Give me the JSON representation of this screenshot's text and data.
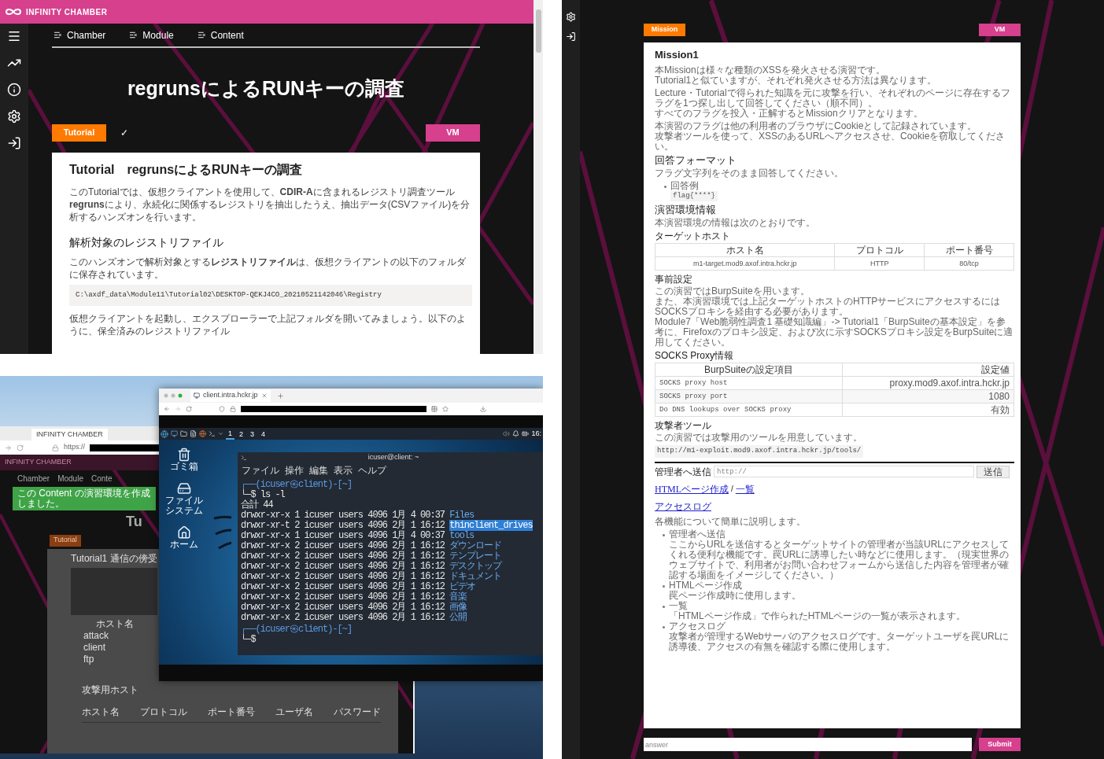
{
  "tutorial_page": {
    "brand": "INFINITY CHAMBER",
    "nav": [
      {
        "label": "Chamber"
      },
      {
        "label": "Module"
      },
      {
        "label": "Content"
      }
    ],
    "title": "regrunsによるRUNキーの調査",
    "tutorial_button": "Tutorial",
    "status_mark": "✓",
    "vm_button": "VM",
    "card": {
      "heading": "Tutorial　regrunsによるRUNキーの調査",
      "intro": "このTutorialでは、仮想クライアントを使用して、**CDIR-A**に含まれるレジストリ調査ツール**regruns**により、永続化に関係するレジストリを抽出したうえ、抽出データ(CSVファイル)を分析するハンズオンを行います。",
      "section": "解析対象のレジストリファイル",
      "paragraph": "このハンズオンで解析対象とする**レジストリファイル**は、仮想クライアントの以下のフォルダに保存されています。",
      "code": "C:\\axdf_data\\Module11\\Tutorial02\\DESKTOP-QEKJ4CO_20210521142046\\Registry",
      "paragraph_2": "仮想クライアントを起動し、エクスプローラーで上記フォルダを開いてみましょう。以下のように、保全済みのレジストリファイル"
    }
  },
  "desktop": {
    "back_window": {
      "tab": "INFINITY CHAMBER",
      "url": "https://",
      "brand": "INFINITY CHAMBER",
      "nav": [
        "Chamber",
        "Module",
        "Conte"
      ],
      "toast": "この Content の演習環境を作成しました。",
      "title": "Tu",
      "tutorial_button": "Tutorial",
      "card_heading": "Tutorial1 通信の傍受",
      "host_table": [
        "ホスト名",
        "attack",
        "client",
        "ftp"
      ],
      "section": "攻撃用ホスト",
      "table_columns": [
        "ホスト名",
        "プロトコル",
        "ポート番号",
        "ユーザ名",
        "パスワード"
      ]
    },
    "front_window": {
      "tab": "client.intra.hckr.jp",
      "workspaces": [
        {
          "label": "1",
          "selected": true
        },
        {
          "label": "2",
          "selected": false
        },
        {
          "label": "3",
          "selected": false
        },
        {
          "label": "4",
          "selected": false
        }
      ],
      "clock": "16:",
      "desktop_icons": [
        {
          "label": "ゴミ箱",
          "kind": "trash"
        },
        {
          "label": "ファイルシステム",
          "kind": "drive"
        },
        {
          "label": "ホーム",
          "kind": "home"
        }
      ],
      "terminal": {
        "title": "icuser@client: ~",
        "menu": [
          "ファイル",
          "操作",
          "編集",
          "表示",
          "ヘルプ"
        ],
        "lines": [
          {
            "kind": "prompt",
            "text": "┌──(icuser㉿client)-[~]"
          },
          {
            "kind": "command",
            "text": "└─$ ls -l"
          },
          {
            "kind": "output",
            "text": "合計 44"
          },
          {
            "kind": "entry",
            "meta": "drwxr-xr-x 1 icuser users 4096 1月 4 00:37",
            "name": "Files",
            "selected": false
          },
          {
            "kind": "entry",
            "meta": "drwxr-xr-t 2 icuser users 4096 2月 1 16:12",
            "name": "thinclient_drives",
            "selected": true
          },
          {
            "kind": "entry",
            "meta": "drwxr-xr-x 1 icuser users 4096 1月 4 00:37",
            "name": "tools",
            "selected": false
          },
          {
            "kind": "entry",
            "meta": "drwxr-xr-x 2 icuser users 4096 2月 1 16:12",
            "name": "ダウンロード",
            "selected": false
          },
          {
            "kind": "entry",
            "meta": "drwxr-xr-x 2 icuser users 4096 2月 1 16:12",
            "name": "テンプレート",
            "selected": false
          },
          {
            "kind": "entry",
            "meta": "drwxr-xr-x 2 icuser users 4096 2月 1 16:12",
            "name": "デスクトップ",
            "selected": false
          },
          {
            "kind": "entry",
            "meta": "drwxr-xr-x 2 icuser users 4096 2月 1 16:12",
            "name": "ドキュメント",
            "selected": false
          },
          {
            "kind": "entry",
            "meta": "drwxr-xr-x 2 icuser users 4096 2月 1 16:12",
            "name": "ビデオ",
            "selected": false
          },
          {
            "kind": "entry",
            "meta": "drwxr-xr-x 2 icuser users 4096 2月 1 16:12",
            "name": "音楽",
            "selected": false
          },
          {
            "kind": "entry",
            "meta": "drwxr-xr-x 2 icuser users 4096 2月 1 16:12",
            "name": "画像",
            "selected": false
          },
          {
            "kind": "entry",
            "meta": "drwxr-xr-x 2 icuser users 4096 2月 1 16:12",
            "name": "公開",
            "selected": false
          },
          {
            "kind": "prompt",
            "text": "┌──(icuser㉿client)-[~]"
          },
          {
            "kind": "command",
            "text": "└─$"
          }
        ]
      }
    }
  },
  "mission_page": {
    "mission_button": "Mission",
    "vm_button": "VM",
    "blocks": [
      {
        "kind": "title",
        "text": "Mission1"
      },
      {
        "kind": "paragraph",
        "lines": [
          "本Missionは様々な種類のXSSを発火させる演習です。",
          "Tutorial1と似ていますが、それぞれ発火させる方法は異なります。"
        ]
      },
      {
        "kind": "paragraph",
        "lines": [
          "Lecture・Tutorialで得られた知識を元に攻撃を行い、それぞれのページに存在するフラグを1つ探し出して回答してください（順不同）。",
          "すべてのフラグを投入・正解するとMissionクリアとなります。"
        ]
      },
      {
        "kind": "paragraph",
        "lines": [
          "本演習のフラグは他の利用者のブラウザにCookieとして記録されています。",
          "攻撃者ツールを使って、XSSのあるURLへアクセスさせ、Cookieを窃取してください。"
        ]
      },
      {
        "kind": "heading",
        "text": "回答フォーマット"
      },
      {
        "kind": "paragraph",
        "lines": [
          "フラグ文字列をそのまま回答してください。"
        ]
      },
      {
        "kind": "bullets",
        "items": [
          {
            "label": "回答例",
            "code": "flag{****}"
          }
        ]
      },
      {
        "kind": "heading",
        "text": "演習環境情報"
      },
      {
        "kind": "paragraph",
        "lines": [
          "本演習環境の情報は次のとおりです。"
        ]
      },
      {
        "kind": "subheading",
        "text": "ターゲットホスト"
      },
      {
        "kind": "table",
        "columns": [
          "ホスト名",
          "プロトコル",
          "ポート番号"
        ],
        "rows": [
          [
            "m1-target.mod9.axof.intra.hckr.jp",
            "HTTP",
            "80/tcp"
          ]
        ]
      },
      {
        "kind": "subheading",
        "text": "事前設定"
      },
      {
        "kind": "paragraph",
        "lines": [
          "この演習ではBurpSuiteを用います。",
          "また、本演習環境では上記ターゲットホストのHTTPサービスにアクセスするにはSOCKSプロキシを経由する必要があります。",
          "Module7「Web脆弱性調査1 基礎知識編」-> Tutorial1「BurpSuiteの基本設定」を参考に、Firefoxのプロキシ設定、および次に示すSOCKSプロキシ設定をBurpSuiteに適用してください。"
        ]
      },
      {
        "kind": "subheading",
        "text": "SOCKS Proxy情報"
      },
      {
        "kind": "settings_table",
        "columns": [
          "BurpSuiteの設定項目",
          "設定値"
        ],
        "rows": [
          [
            "SOCKS proxy host",
            "proxy.mod9.axof.intra.hckr.jp"
          ],
          [
            "SOCKS proxy port",
            "1080"
          ],
          [
            "Do DNS lookups over SOCKS proxy",
            "有効"
          ]
        ]
      },
      {
        "kind": "subheading",
        "text": "攻撃者ツール"
      },
      {
        "kind": "paragraph",
        "lines": [
          "この演習では攻撃用のツールを用意しています。"
        ]
      },
      {
        "kind": "code",
        "text": "http://m1-exploit.mod9.axof.intra.hckr.jp/tools/"
      },
      {
        "kind": "rule"
      },
      {
        "kind": "form",
        "label": "管理者へ送信",
        "placeholder": "http://",
        "button": "送信"
      },
      {
        "kind": "links",
        "links": [
          "HTMLページ作成",
          "一覧"
        ],
        "separator": "/"
      },
      {
        "kind": "links",
        "links": [
          "アクセスログ"
        ]
      },
      {
        "kind": "paragraph",
        "lines": [
          "各機能について簡単に説明します。"
        ]
      },
      {
        "kind": "definitions",
        "items": [
          {
            "term": "管理者へ送信",
            "text": "ここからURLを送信するとターゲットサイトの管理者が当該URLにアクセスしてくれる便利な機能です。罠URLに誘導したい時などに使用します。（現実世界のウェブサイトで、利用者がお問い合わせフォームから送信した内容を管理者が確認する場面をイメージしてください。）"
          },
          {
            "term": "HTMLページ作成",
            "text": "罠ページ作成時に使用します。"
          },
          {
            "term": "一覧",
            "text": "「HTMLページ作成」で作られたHTMLページの一覧が表示されます。"
          },
          {
            "term": "アクセスログ",
            "text": "攻撃者が管理するWebサーバのアクセスログです。ターゲットユーザを罠URLに誘導後、アクセスの有無を確認する際に使用します。"
          }
        ]
      }
    ],
    "answer": {
      "placeholder": "answer"
    },
    "submit_button": "Submit"
  }
}
